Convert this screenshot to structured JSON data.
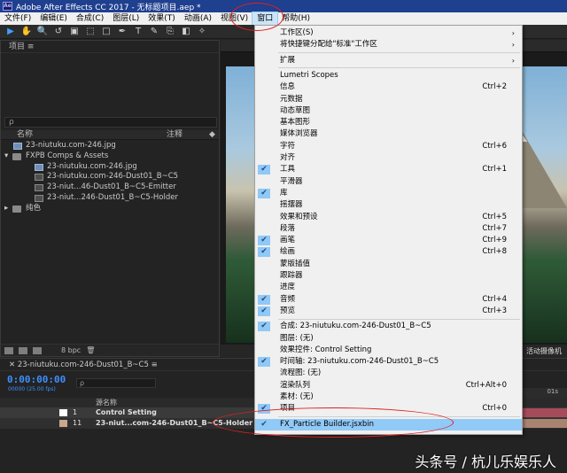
{
  "titlebar": {
    "app_icon": "Ae",
    "title": "Adobe After Effects CC 2017 - 无标题项目.aep *"
  },
  "menubar": [
    "文件(F)",
    "编辑(E)",
    "合成(C)",
    "图层(L)",
    "效果(T)",
    "动画(A)",
    "视图(V)",
    "窗口",
    "帮助(H)"
  ],
  "toolbar": {
    "icons": [
      "selection-tool-icon",
      "hand-tool-icon",
      "zoom-tool-icon",
      "rotate-tool-icon",
      "camera-tool-icon",
      "pan-behind-tool-icon",
      "rectangle-tool-icon",
      "pen-tool-icon",
      "type-tool-icon",
      "brush-tool-icon",
      "clone-stamp-tool-icon",
      "eraser-tool-icon",
      "roto-brush-tool-icon"
    ]
  },
  "project": {
    "tab_label": "项目",
    "columns": {
      "name": "名称",
      "comment": "注释"
    },
    "rows": [
      {
        "type": "jpg",
        "indent": 0,
        "label": "23-niutuku.com-246.jpg"
      },
      {
        "type": "folder",
        "indent": 0,
        "label": "FXPB Comps & Assets"
      },
      {
        "type": "jpg",
        "indent": 1,
        "label": "23-niutuku.com-246.jpg"
      },
      {
        "type": "comp",
        "indent": 1,
        "label": "23-niutuku.com-246-Dust01_B~C5"
      },
      {
        "type": "comp",
        "indent": 1,
        "label": "23-niut...46-Dust01_B~C5-Emitter"
      },
      {
        "type": "comp",
        "indent": 1,
        "label": "23-niut...246-Dust01_B~C5-Holder"
      },
      {
        "type": "folder",
        "indent": 0,
        "label": "纯色"
      }
    ],
    "bpc": "8 bpc"
  },
  "viewer": {
    "tab_label": "活动摄像机",
    "bottom_label": "活动摄像机"
  },
  "timeline": {
    "tab_label": "23-niutuku.com-246-Dust01_B~C5",
    "timecode": "0:00:00:00",
    "fps": "00000 (25.00 fps)",
    "search_placeholder": "ρ",
    "source_name_header": "源名称",
    "ruler_mark": "01s",
    "layers": [
      {
        "num": "1",
        "name": "Control Setting",
        "swatch": "#ffffff"
      },
      {
        "num": "11",
        "name": "23-niut...com-246-Dust01_B~C5-Holder",
        "swatch": "#c9a88c"
      }
    ]
  },
  "window_menu": {
    "items": [
      {
        "label": "工作区(S)",
        "shortcut": "",
        "checked": false,
        "submenu": true
      },
      {
        "label": "将快捷键分配给\"标准\"工作区",
        "shortcut": "",
        "checked": false,
        "submenu": true
      },
      {
        "sep": true
      },
      {
        "label": "扩展",
        "shortcut": "",
        "checked": false,
        "submenu": true
      },
      {
        "sep": true
      },
      {
        "label": "Lumetri Scopes",
        "shortcut": "",
        "checked": false
      },
      {
        "label": "信息",
        "shortcut": "Ctrl+2",
        "checked": false
      },
      {
        "label": "元数据",
        "shortcut": "",
        "checked": false
      },
      {
        "label": "动态草图",
        "shortcut": "",
        "checked": false
      },
      {
        "label": "基本图形",
        "shortcut": "",
        "checked": false
      },
      {
        "label": "媒体浏览器",
        "shortcut": "",
        "checked": false
      },
      {
        "label": "字符",
        "shortcut": "Ctrl+6",
        "checked": false
      },
      {
        "label": "对齐",
        "shortcut": "",
        "checked": false
      },
      {
        "label": "工具",
        "shortcut": "Ctrl+1",
        "checked": true
      },
      {
        "label": "平滑器",
        "shortcut": "",
        "checked": false
      },
      {
        "label": "库",
        "shortcut": "",
        "checked": true
      },
      {
        "label": "摇摆器",
        "shortcut": "",
        "checked": false
      },
      {
        "label": "效果和预设",
        "shortcut": "Ctrl+5",
        "checked": false
      },
      {
        "label": "段落",
        "shortcut": "Ctrl+7",
        "checked": false
      },
      {
        "label": "画笔",
        "shortcut": "Ctrl+9",
        "checked": true
      },
      {
        "label": "绘画",
        "shortcut": "Ctrl+8",
        "checked": true
      },
      {
        "label": "蒙版插值",
        "shortcut": "",
        "checked": false
      },
      {
        "label": "跟踪器",
        "shortcut": "",
        "checked": false
      },
      {
        "label": "进度",
        "shortcut": "",
        "checked": false
      },
      {
        "label": "音频",
        "shortcut": "Ctrl+4",
        "checked": true
      },
      {
        "label": "预览",
        "shortcut": "Ctrl+3",
        "checked": true
      },
      {
        "sep": true
      },
      {
        "label": "合成: 23-niutuku.com-246-Dust01_B~C5",
        "shortcut": "",
        "checked": true
      },
      {
        "label": "图层: (无)",
        "shortcut": "",
        "checked": false
      },
      {
        "label": "效果控件: Control Setting",
        "shortcut": "",
        "checked": false
      },
      {
        "label": "时间轴: 23-niutuku.com-246-Dust01_B~C5",
        "shortcut": "",
        "checked": true
      },
      {
        "label": "流程图: (无)",
        "shortcut": "",
        "checked": false
      },
      {
        "label": "渲染队列",
        "shortcut": "Ctrl+Alt+0",
        "checked": false
      },
      {
        "label": "素材: (无)",
        "shortcut": "",
        "checked": false
      },
      {
        "label": "项目",
        "shortcut": "Ctrl+0",
        "checked": true
      },
      {
        "sep": true
      },
      {
        "label": "FX_Particle Builder.jsxbin",
        "shortcut": "",
        "checked": true,
        "highlight": true
      }
    ]
  },
  "watermark": "头条号 / 杭儿乐娱乐人",
  "colors": {
    "accent_blue": "#3f8fff",
    "menu_highlight": "#91c9f7",
    "annotation_red": "#e02020",
    "titlebar": "#1f3f8f"
  }
}
